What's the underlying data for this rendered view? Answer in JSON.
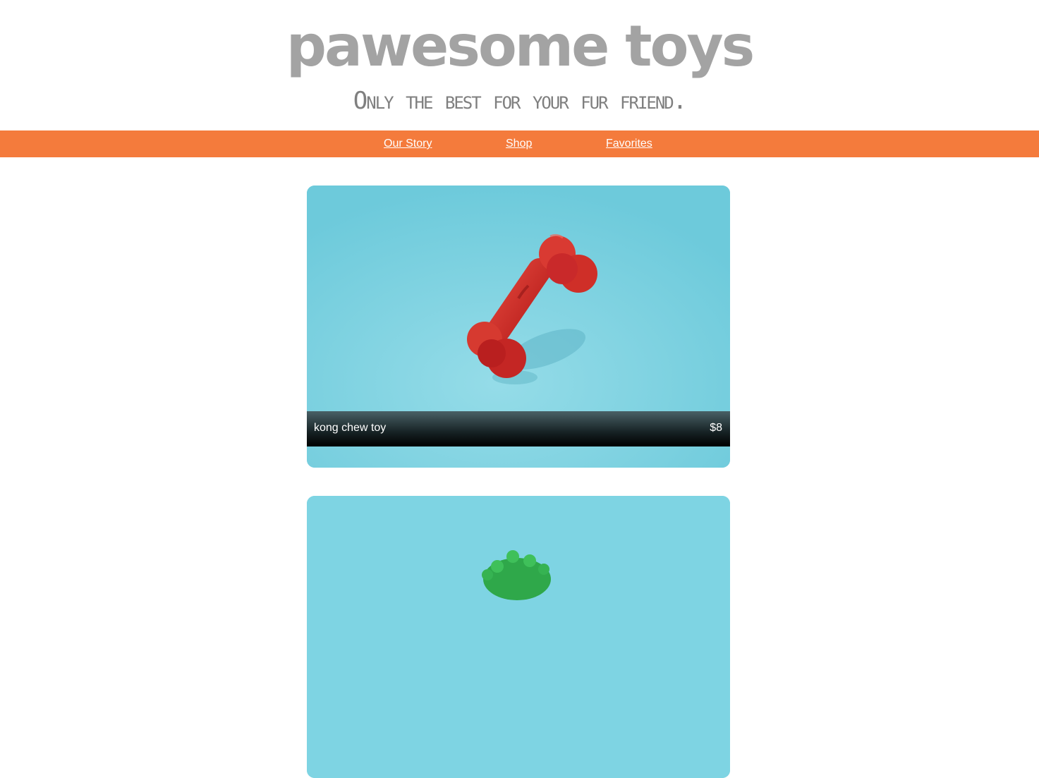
{
  "header": {
    "title": "pawesome toys",
    "tagline": "Only the best for your fur friend."
  },
  "nav": {
    "items": [
      {
        "label": "Our Story"
      },
      {
        "label": "Shop"
      },
      {
        "label": "Favorites"
      }
    ]
  },
  "products": [
    {
      "name": "kong chew toy",
      "price": "$8",
      "image_icon": "red-bone-toy"
    },
    {
      "image_icon": "green-spiky-ball-toy"
    }
  ],
  "colors": {
    "nav_background": "#f47b3c",
    "title": "#a3a3a3",
    "tagline": "#7f7f7f",
    "card_background": "#7dd3e2"
  }
}
